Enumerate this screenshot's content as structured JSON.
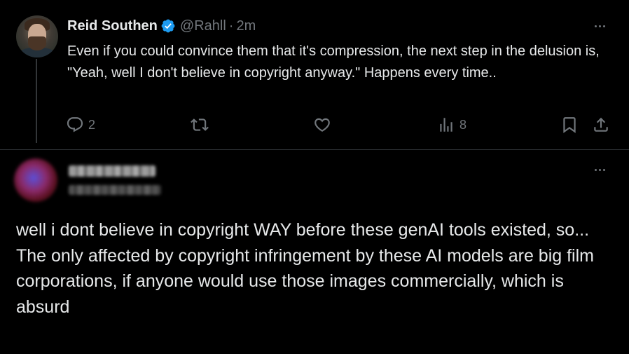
{
  "tweet": {
    "author_name": "Reid Southen",
    "handle": "@Rahll",
    "separator": "·",
    "time": "2m",
    "text": "Even if you could convince them that it's compression, the next step in the delusion is, \"Yeah, well I don't believe in copyright anyway.\" Happens every time..",
    "actions": {
      "reply_count": "2",
      "views_count": "8"
    },
    "icons": [
      "verified-badge-icon",
      "more-icon",
      "reply-icon",
      "repost-icon",
      "like-icon",
      "views-icon",
      "bookmark-icon",
      "share-icon"
    ]
  },
  "reply": {
    "text": "well i dont believe in copyright WAY before these genAI tools existed, so...\nThe only affected by copyright infringement by these AI models are big film corporations, if anyone would use those images commercially, which is absurd",
    "icons": [
      "more-icon"
    ]
  },
  "colors": {
    "background": "#000000",
    "text_primary": "#e7e9ea",
    "text_secondary": "#71767b",
    "verified_blue": "#1d9bf0",
    "divider": "#2f3336"
  }
}
